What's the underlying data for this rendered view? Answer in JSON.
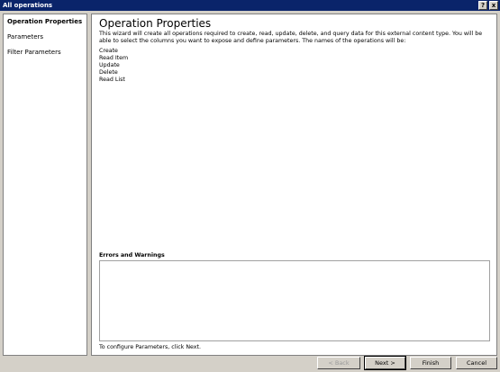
{
  "window": {
    "title": "All operations",
    "help_glyph": "?",
    "close_glyph": "x"
  },
  "nav": {
    "items": [
      {
        "label": "Operation Properties"
      },
      {
        "label": "Parameters"
      },
      {
        "label": "Filter Parameters"
      }
    ]
  },
  "main": {
    "heading": "Operation Properties",
    "description": "This wizard will create all operations required to create, read, update, delete, and query data for this external content type. You will be able to select the columns you want to expose and define parameters. The names of the operations will be:",
    "operations": [
      "Create",
      "Read Item",
      "Update",
      "Delete",
      "Read List"
    ],
    "errors_label": "Errors and Warnings",
    "hint": "To configure Parameters, click Next."
  },
  "buttons": {
    "back": "< Back",
    "next": "Next >",
    "finish": "Finish",
    "cancel": "Cancel"
  }
}
